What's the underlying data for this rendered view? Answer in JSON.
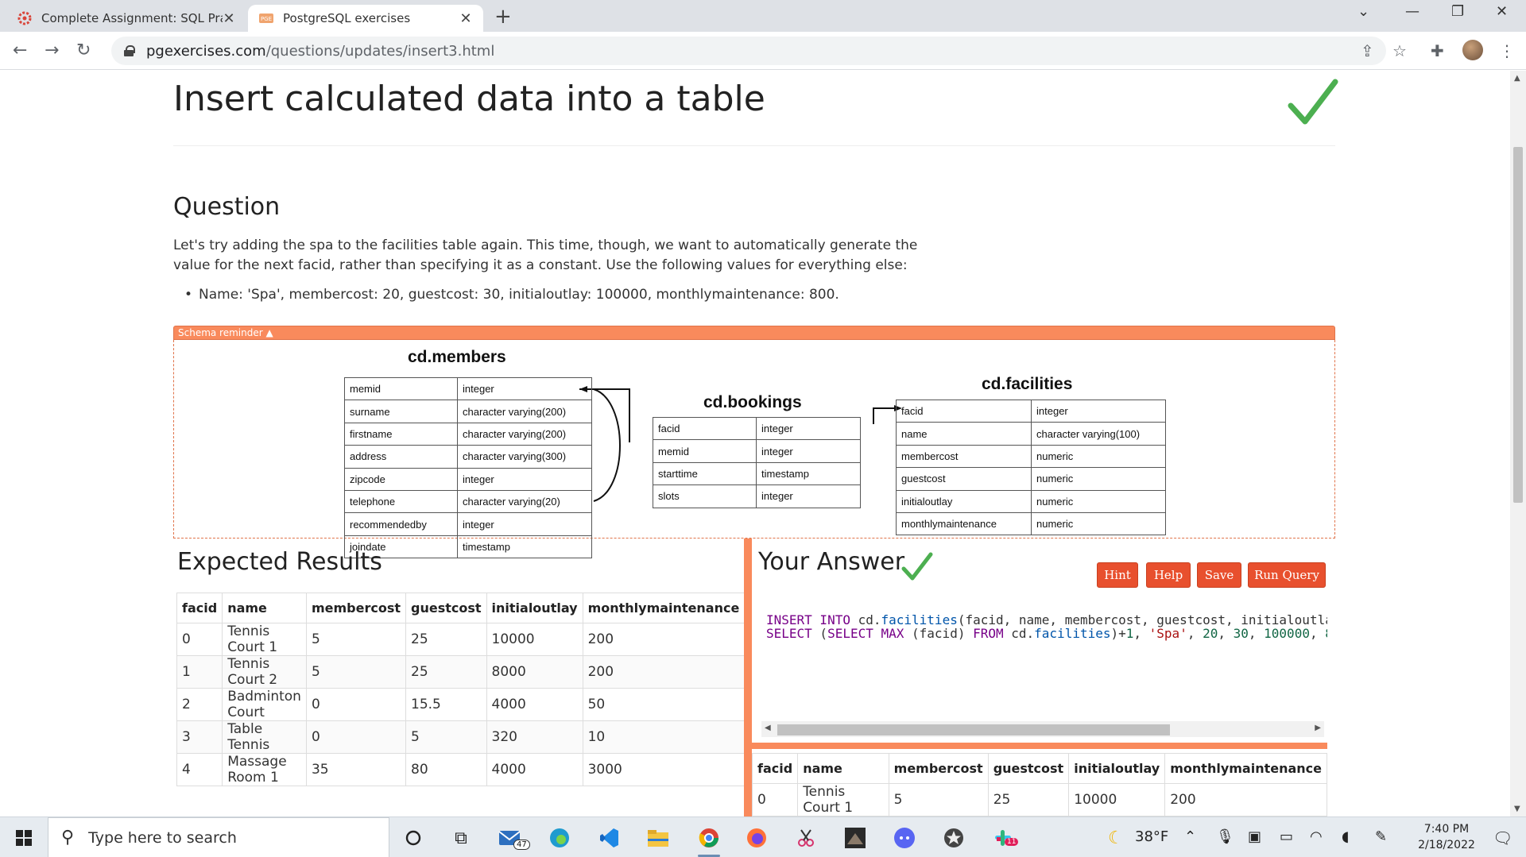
{
  "browser": {
    "tabs": [
      {
        "title": "Complete Assignment: SQL Pract",
        "favicon": "gear-red-icon"
      },
      {
        "title": "PostgreSQL exercises",
        "favicon": "pge-icon"
      }
    ],
    "url_domain": "pgexercises.com",
    "url_path": "/questions/updates/insert3.html"
  },
  "page": {
    "title": "Insert calculated data into a table",
    "question_heading": "Question",
    "question_text": "Let's try adding the spa to the facilities table again. This time, though, we want to automatically generate the value for the next facid, rather than specifying it as a constant. Use the following values for everything else:",
    "bullet": "Name: 'Spa', membercost: 20, guestcost: 30, initialoutlay: 100000, monthlymaintenance: 800.",
    "schema_toggle": "Schema reminder ▲"
  },
  "schema": {
    "members": {
      "title": "cd.members",
      "rows": [
        [
          "memid",
          "integer"
        ],
        [
          "surname",
          "character varying(200)"
        ],
        [
          "firstname",
          "character varying(200)"
        ],
        [
          "address",
          "character varying(300)"
        ],
        [
          "zipcode",
          "integer"
        ],
        [
          "telephone",
          "character varying(20)"
        ],
        [
          "recommendedby",
          "integer"
        ],
        [
          "joindate",
          "timestamp"
        ]
      ]
    },
    "bookings": {
      "title": "cd.bookings",
      "rows": [
        [
          "facid",
          "integer"
        ],
        [
          "memid",
          "integer"
        ],
        [
          "starttime",
          "timestamp"
        ],
        [
          "slots",
          "integer"
        ]
      ]
    },
    "facilities": {
      "title": "cd.facilities",
      "rows": [
        [
          "facid",
          "integer"
        ],
        [
          "name",
          "character varying(100)"
        ],
        [
          "membercost",
          "numeric"
        ],
        [
          "guestcost",
          "numeric"
        ],
        [
          "initialoutlay",
          "numeric"
        ],
        [
          "monthlymaintenance",
          "numeric"
        ]
      ]
    }
  },
  "expected": {
    "heading": "Expected Results",
    "columns": [
      "facid",
      "name",
      "membercost",
      "guestcost",
      "initialoutlay",
      "monthlymaintenance"
    ],
    "rows": [
      [
        "0",
        "Tennis Court 1",
        "5",
        "25",
        "10000",
        "200"
      ],
      [
        "1",
        "Tennis Court 2",
        "5",
        "25",
        "8000",
        "200"
      ],
      [
        "2",
        "Badminton Court",
        "0",
        "15.5",
        "4000",
        "50"
      ],
      [
        "3",
        "Table Tennis",
        "0",
        "5",
        "320",
        "10"
      ],
      [
        "4",
        "Massage Room 1",
        "35",
        "80",
        "4000",
        "3000"
      ]
    ]
  },
  "answer": {
    "heading": "Your Answer",
    "buttons": {
      "hint": "Hint",
      "help": "Help",
      "save": "Save",
      "run": "Run Query"
    },
    "code_line1": "INSERT INTO cd.facilities(facid, name, membercost, guestcost, initialoutla",
    "code_line2": "SELECT (SELECT MAX (facid) FROM cd.facilities)+1, 'Spa', 20, 30, 100000, 8",
    "result_columns": [
      "facid",
      "name",
      "membercost",
      "guestcost",
      "initialoutlay",
      "monthlymaintenance"
    ],
    "result_partial_row": [
      "0",
      "Tennis Court 1",
      "5",
      "25",
      "10000",
      "200"
    ]
  },
  "taskbar": {
    "search_placeholder": "Type here to search",
    "mail_badge": "47",
    "slack_badge": "11",
    "weather": "38°F",
    "time": "7:40 PM",
    "date": "2/18/2022"
  },
  "colors": {
    "accent": "#f98a5c",
    "button": "#e8502e",
    "check": "#4caf50"
  }
}
